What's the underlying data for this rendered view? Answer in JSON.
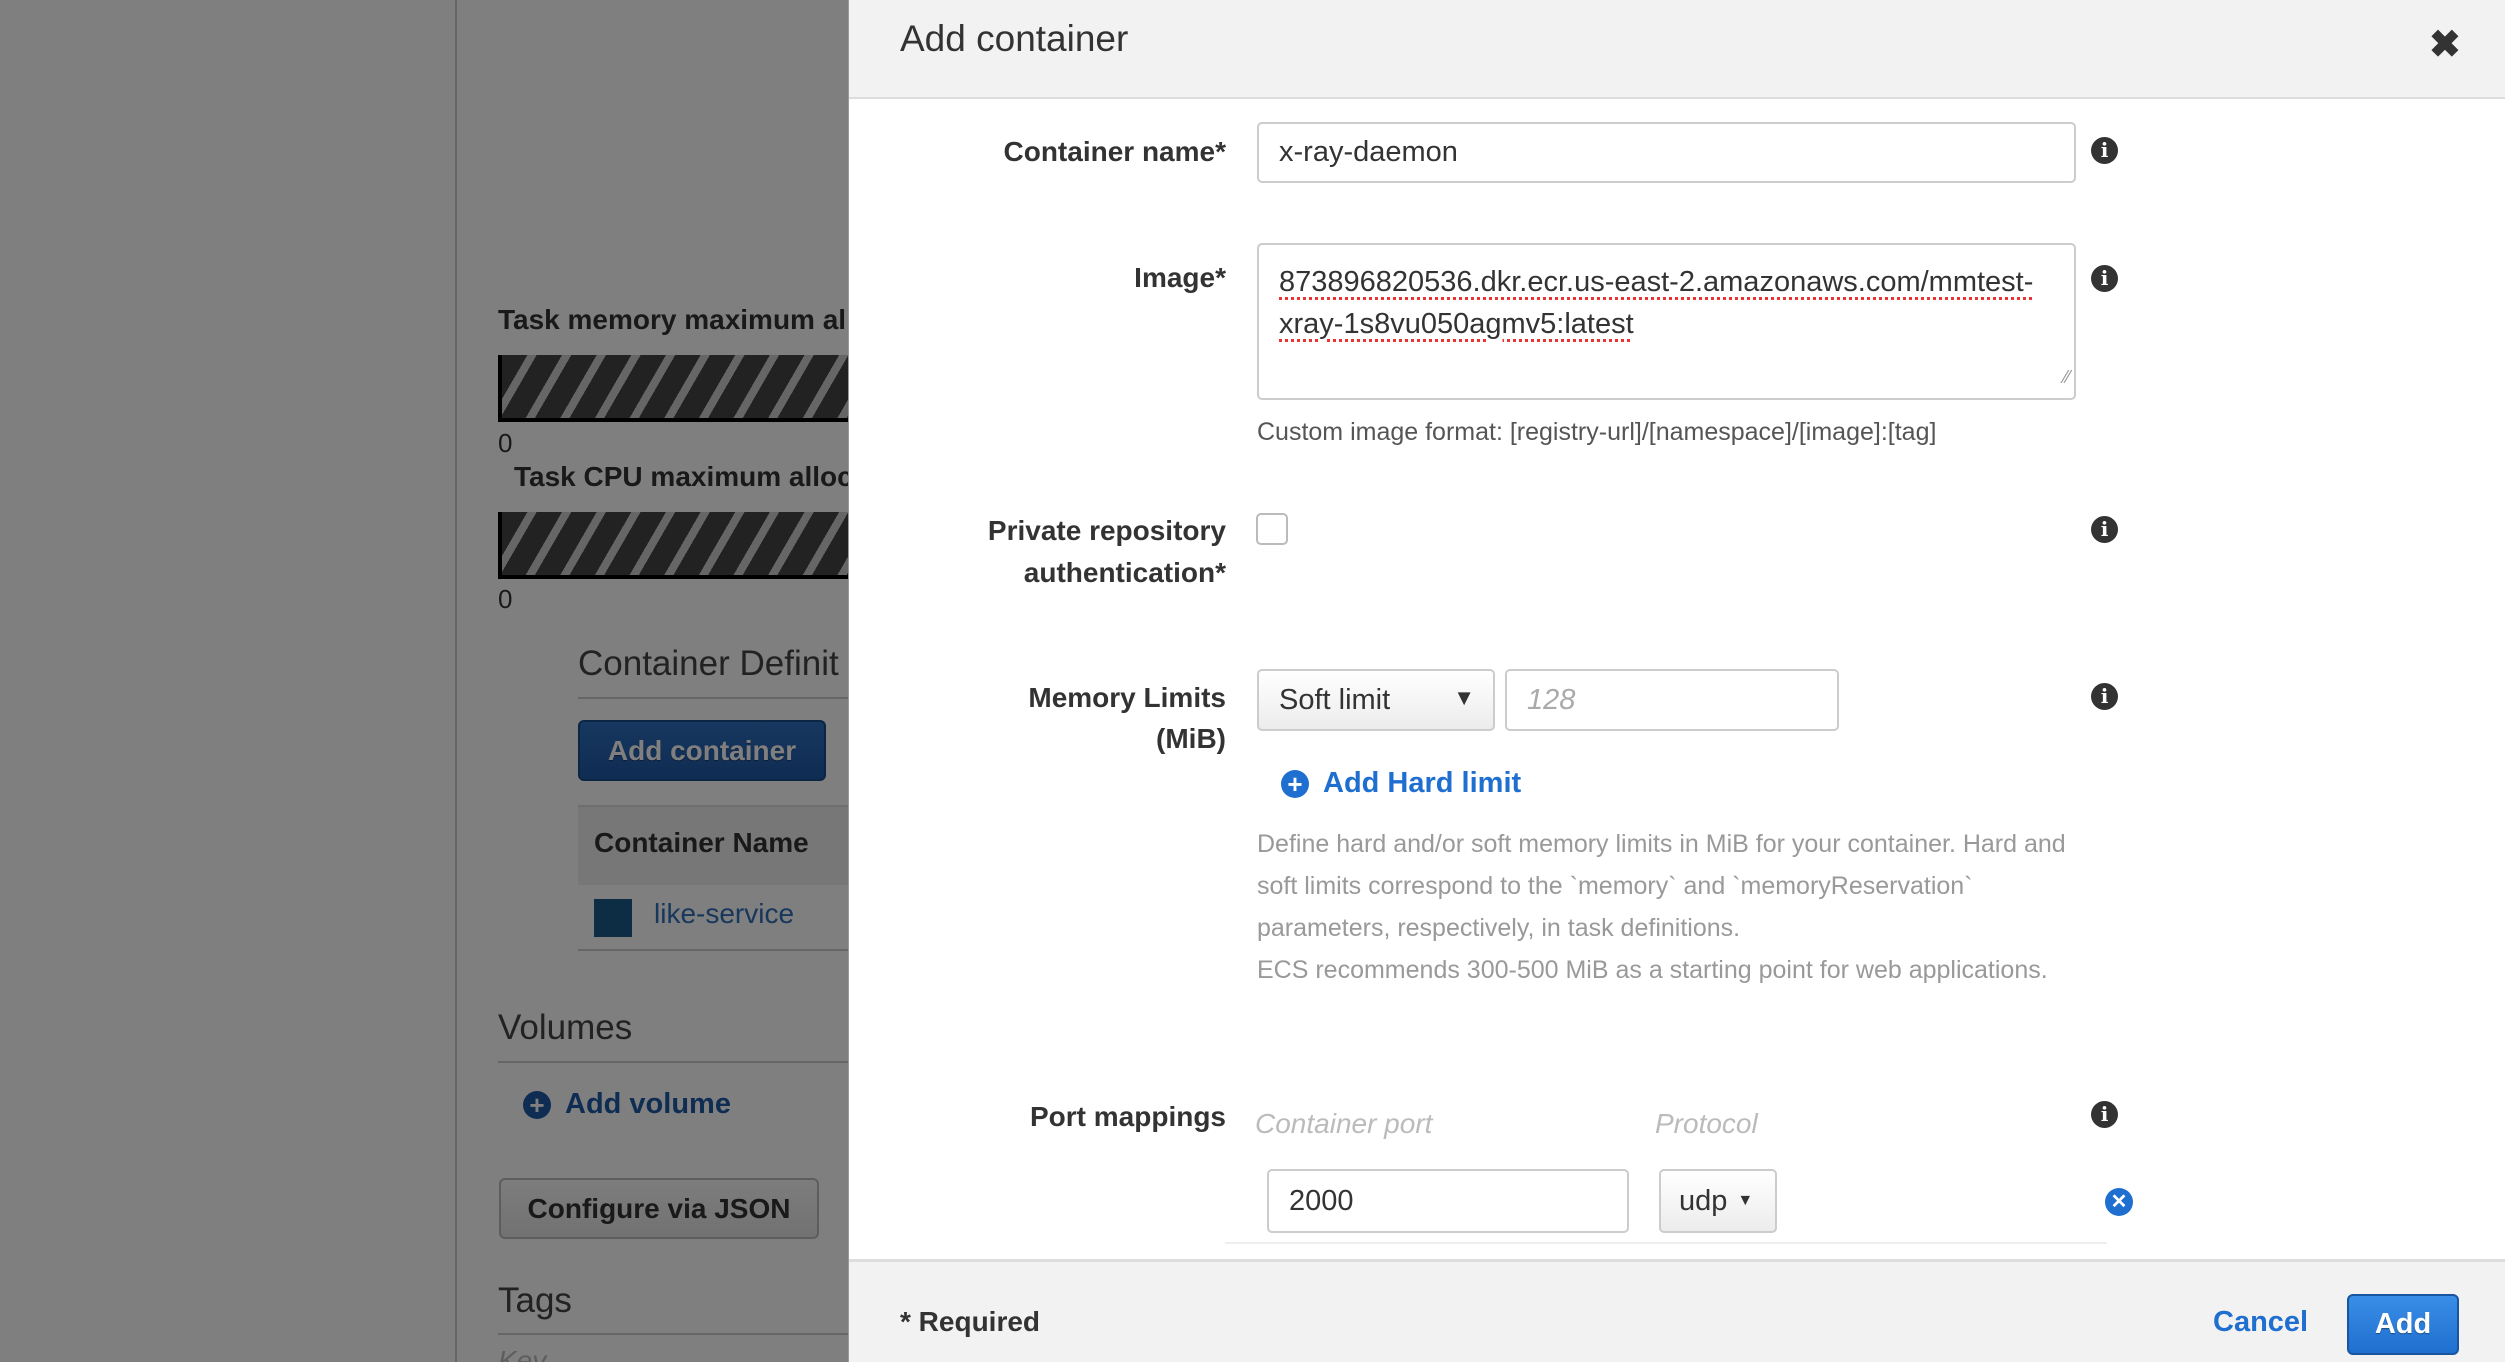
{
  "background": {
    "task_memory_label": "Task memory maximum al",
    "task_memory_value": "0",
    "task_cpu_label": "Task CPU maximum alloc",
    "task_cpu_value": "0",
    "container_definitions_heading": "Container Definit",
    "add_container_button": "Add container",
    "table_header_container_name": "Container Name",
    "containers": [
      {
        "name": "like-service",
        "color": "#1a5a8a"
      }
    ],
    "volumes_heading": "Volumes",
    "add_volume_link": "Add volume",
    "configure_json_button": "Configure via JSON",
    "tags_heading": "Tags",
    "tags_key_placeholder": "Key"
  },
  "modal": {
    "title": "Add container",
    "close_icon": "close-icon",
    "container_name": {
      "label": "Container name*",
      "value": "x-ray-daemon"
    },
    "image": {
      "label": "Image*",
      "value_line1": "873896820536.dkr.ecr.us-east-2.amazonaws.com/mmtest-",
      "value_line2": "xray-1s8vu050agmv5:latest",
      "help": "Custom image format: [registry-url]/[namespace]/[image]:[tag]"
    },
    "private_repo": {
      "label_line1": "Private repository",
      "label_line2": "authentication*",
      "checked": false
    },
    "memory_limits": {
      "label_line1": "Memory Limits",
      "label_line2": "(MiB)",
      "limit_type": "Soft limit",
      "value_placeholder": "128",
      "add_hard_limit": "Add Hard limit",
      "help_lines": [
        "Define hard and/or soft memory limits in MiB for your container. Hard and",
        "soft limits correspond to the `memory` and `memoryReservation`",
        "parameters, respectively, in task definitions.",
        "ECS recommends 300-500 MiB as a starting point for web applications."
      ]
    },
    "port_mappings": {
      "label": "Port mappings",
      "col_container_port": "Container port",
      "col_protocol": "Protocol",
      "rows": [
        {
          "container_port": "2000",
          "protocol": "udp"
        }
      ]
    },
    "footer": {
      "required_note": "* Required",
      "cancel": "Cancel",
      "add": "Add"
    },
    "accent_color": "#1f6fd0"
  }
}
